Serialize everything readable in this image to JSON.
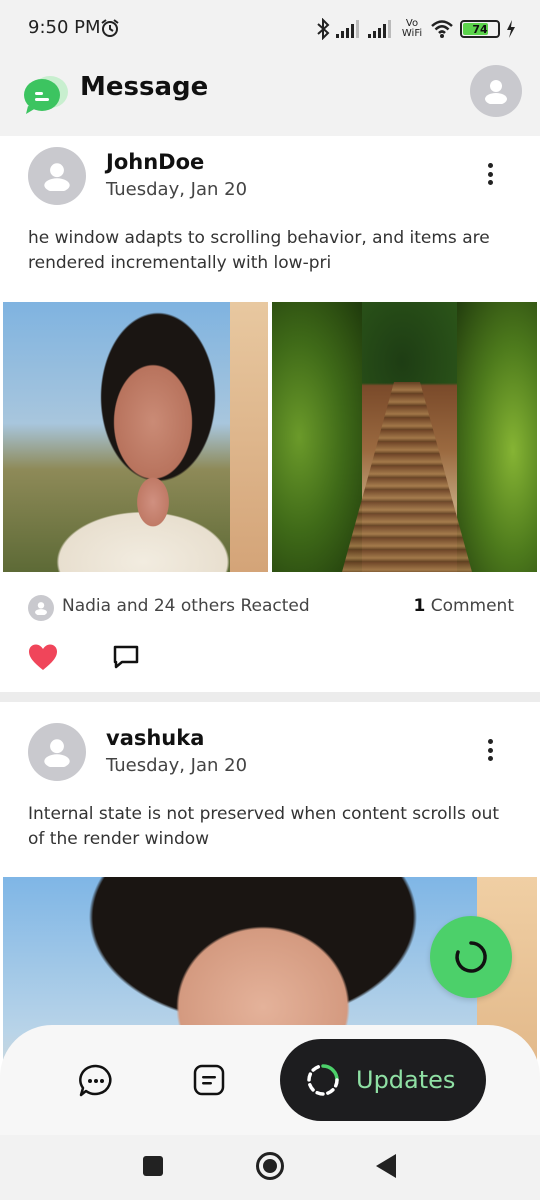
{
  "status_bar": {
    "time": "9:50 PM",
    "battery": "74",
    "network": "Vo WiFi",
    "icons": [
      "alarm-icon",
      "bluetooth-icon",
      "signal-icon",
      "signal-icon",
      "wifi-icon",
      "battery-icon",
      "charging-icon"
    ]
  },
  "header": {
    "title": "Message",
    "logo_icon": "chat-bubble-logo",
    "profile_icon": "user-avatar-icon"
  },
  "posts": [
    {
      "author": "JohnDoe",
      "date": "Tuesday, Jan 20",
      "text": "he window adapts to scrolling behavior, and items are rendered incrementally with low-pri",
      "reactions": "Nadia and 24 others Reacted",
      "comment_count": "1",
      "comment_label": "Comment",
      "liked": true
    },
    {
      "author": "vashuka",
      "date": "Tuesday, Jan 20",
      "text": "Internal state is not preserved when content scrolls out of the render window"
    }
  ],
  "bottom_nav": {
    "updates_label": "Updates",
    "items": [
      "chat-icon",
      "notes-icon",
      "updates-icon"
    ]
  },
  "colors": {
    "accent_green": "#4cd06a",
    "like_red": "#f0455a",
    "dark_pill": "#1d1d1f",
    "updates_text": "#8fe0a4"
  }
}
